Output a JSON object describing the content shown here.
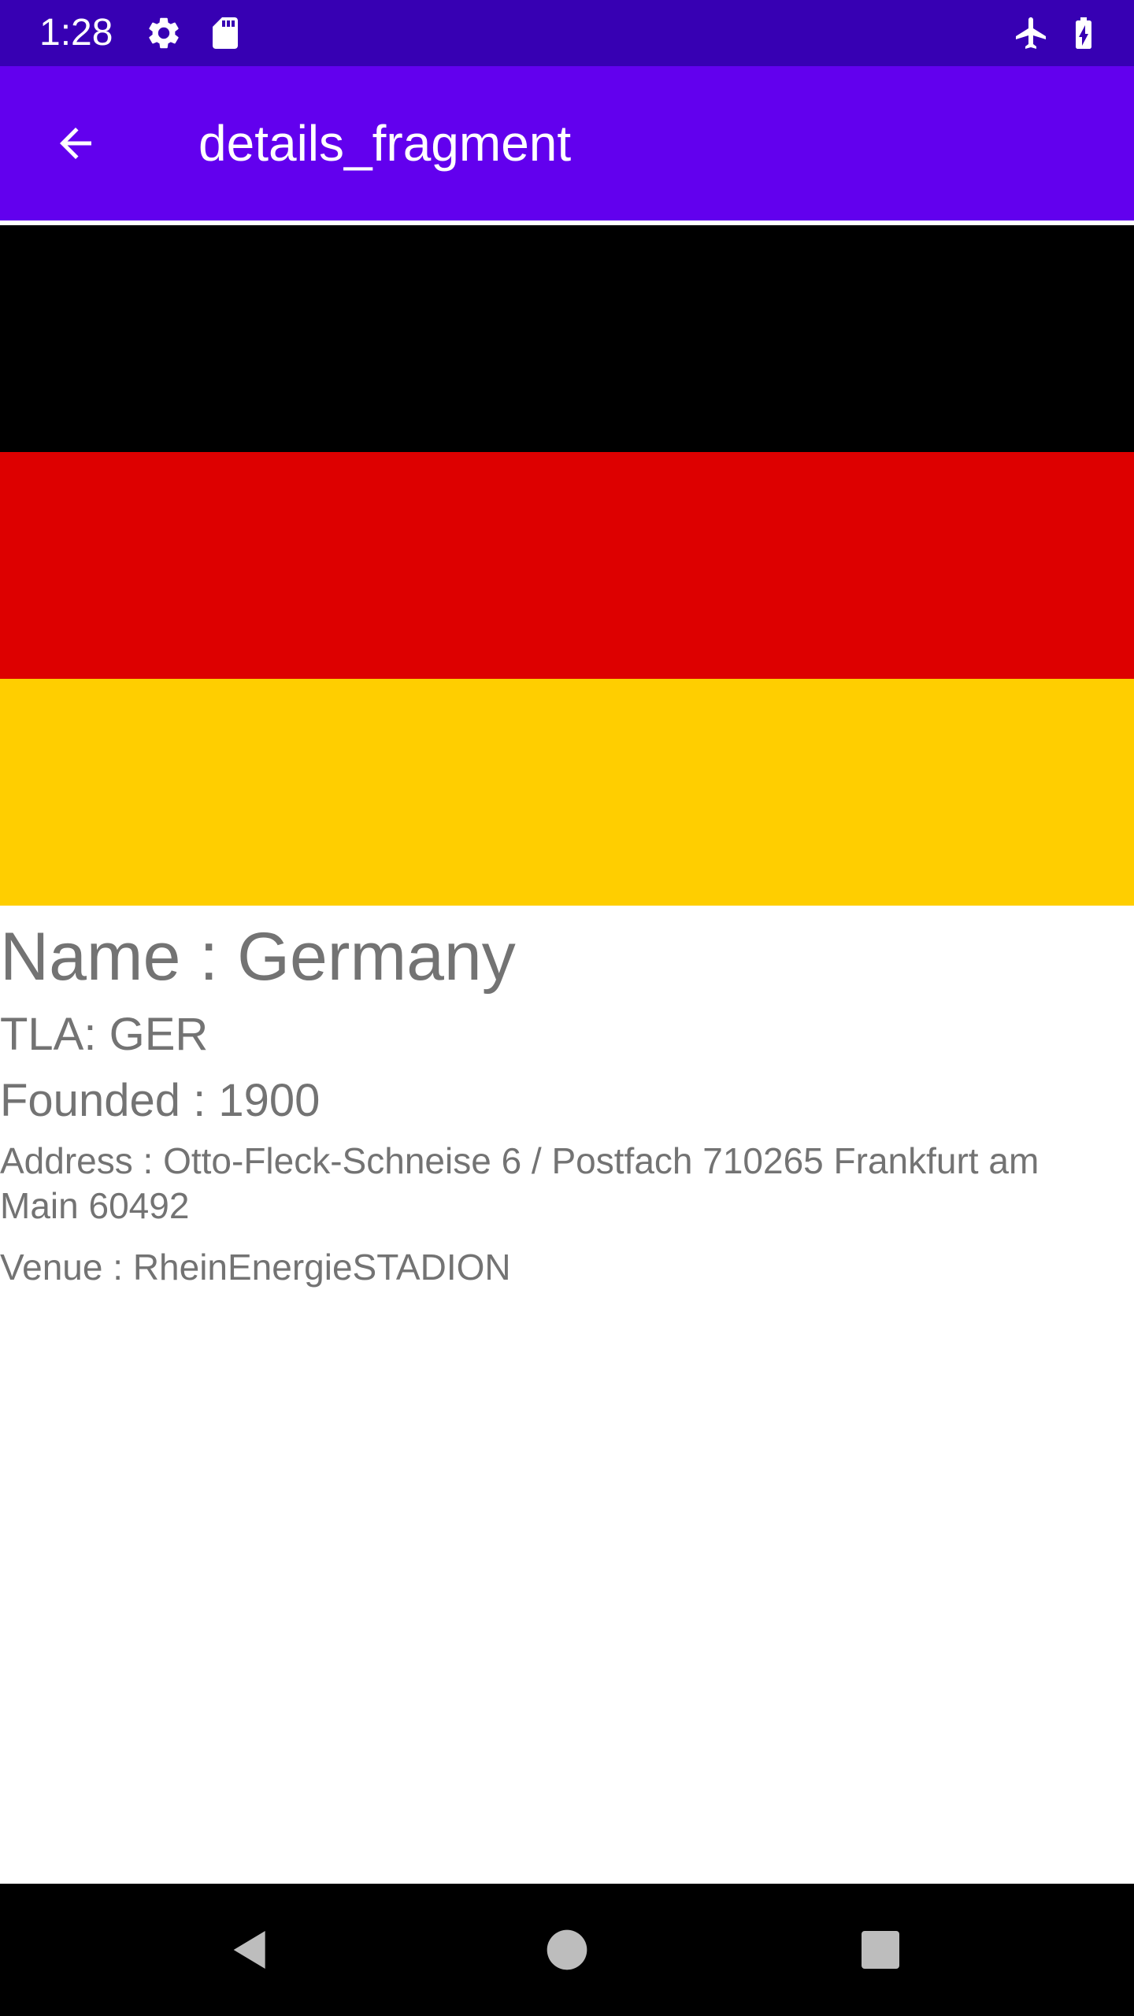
{
  "status_bar": {
    "time": "1:28",
    "icons": [
      "settings-icon",
      "sd-card-icon",
      "airplane-mode-icon",
      "battery-charging-icon"
    ]
  },
  "app_bar": {
    "title": "details_fragment",
    "back_icon": "arrow-back-icon"
  },
  "flag": {
    "stripes": [
      "#000000",
      "#dd0000",
      "#ffce00"
    ]
  },
  "details": {
    "name": "Name : Germany",
    "tla": "TLA: GER",
    "founded": "Founded : 1900",
    "address": "Address : Otto-Fleck-Schneise 6 / Postfach 710265 Frankfurt am Main 60492",
    "venue": "Venue : RheinEnergieSTADION"
  },
  "nav_bar": {
    "buttons": [
      "back-triangle-icon",
      "home-circle-icon",
      "recents-square-icon"
    ]
  },
  "colors": {
    "status_bar": "#3700b3",
    "app_bar": "#6200ee",
    "text_secondary": "#737373"
  }
}
